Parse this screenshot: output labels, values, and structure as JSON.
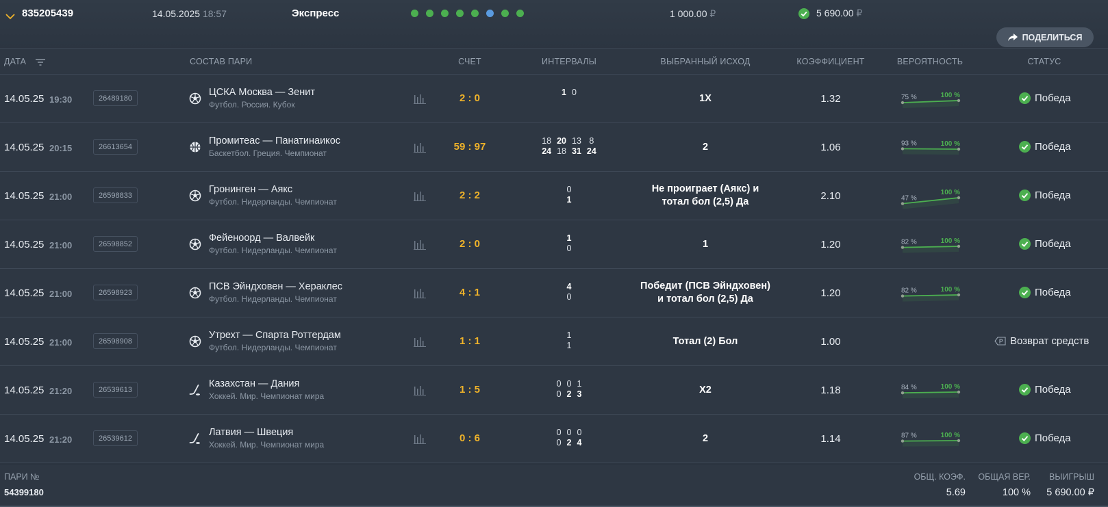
{
  "header": {
    "bet_number": "835205439",
    "date": "14.05.2025",
    "time": "18:57",
    "bet_type": "Экспресс",
    "event_dots": [
      "green",
      "green",
      "green",
      "green",
      "green",
      "blue",
      "green",
      "green"
    ],
    "stake_amount": "1 000.00",
    "currency": "₽",
    "win_amount": "5 690.00",
    "share_label": "ПОДЕЛИТЬСЯ"
  },
  "columns": {
    "date": "ДАТА",
    "pair": "СОСТАВ ПАРИ",
    "score": "СЧЕТ",
    "intervals": "ИНТЕРВАЛЫ",
    "outcome": "ВЫБРАННЫЙ ИСХОД",
    "coefficient": "КОЭФФИЦИЕНТ",
    "probability": "ВЕРОЯТНОСТЬ",
    "status": "СТАТУС"
  },
  "rows": [
    {
      "date": "14.05.25",
      "time": "19:30",
      "event_id": "26489180",
      "sport_icon": "football-icon",
      "teams": "ЦСКА Москва — Зенит",
      "league": "Футбол. Россия. Кубок",
      "score": "2 : 0",
      "interval_cols": 2,
      "intervals": [
        [
          "1"
        ],
        [
          "0"
        ]
      ],
      "interval_bold": [
        [
          true
        ],
        [
          false
        ]
      ],
      "outcome_lines": [
        "1X"
      ],
      "coef": "1.32",
      "prob_from": "75 %",
      "prob_to": "100 %",
      "prob_from_value": 0.75,
      "status": "Победа",
      "status_icon": "check-circle-icon"
    },
    {
      "date": "14.05.25",
      "time": "20:15",
      "event_id": "26613654",
      "sport_icon": "basketball-icon",
      "teams": "Промитеас — Панатинаикос",
      "league": "Баскетбол. Греция. Чемпионат",
      "score": "59 : 97",
      "interval_cols": 4,
      "intervals": [
        [
          "18",
          "20",
          "13",
          "8"
        ],
        [
          "24",
          "18",
          "31",
          "24"
        ]
      ],
      "interval_bold": [
        [
          false,
          true,
          false,
          false
        ],
        [
          true,
          false,
          true,
          true
        ]
      ],
      "outcome_lines": [
        "2"
      ],
      "coef": "1.06",
      "prob_from": "93 %",
      "prob_to": "100 %",
      "prob_from_value": 0.93,
      "status": "Победа",
      "status_icon": "check-circle-icon"
    },
    {
      "date": "14.05.25",
      "time": "21:00",
      "event_id": "26598833",
      "sport_icon": "football-icon",
      "teams": "Гронинген — Аякс",
      "league": "Футбол. Нидерланды. Чемпионат",
      "score": "2 : 2",
      "interval_cols": 1,
      "intervals": [
        [
          "0"
        ],
        [
          "1"
        ]
      ],
      "interval_bold": [
        [
          false
        ],
        [
          true
        ]
      ],
      "outcome_lines": [
        "Не проиграет (Аякс) и",
        "тотал бол (2,5) Да"
      ],
      "coef": "2.10",
      "prob_from": "47 %",
      "prob_to": "100 %",
      "prob_from_value": 0.47,
      "status": "Победа",
      "status_icon": "check-circle-icon"
    },
    {
      "date": "14.05.25",
      "time": "21:00",
      "event_id": "26598852",
      "sport_icon": "football-icon",
      "teams": "Фейеноорд — Валвейк",
      "league": "Футбол. Нидерланды. Чемпионат",
      "score": "2 : 0",
      "interval_cols": 1,
      "intervals": [
        [
          "1"
        ],
        [
          "0"
        ]
      ],
      "interval_bold": [
        [
          true
        ],
        [
          false
        ]
      ],
      "outcome_lines": [
        "1"
      ],
      "coef": "1.20",
      "prob_from": "82 %",
      "prob_to": "100 %",
      "prob_from_value": 0.82,
      "status": "Победа",
      "status_icon": "check-circle-icon"
    },
    {
      "date": "14.05.25",
      "time": "21:00",
      "event_id": "26598923",
      "sport_icon": "football-icon",
      "teams": "ПСВ Эйндховен — Хераклес",
      "league": "Футбол. Нидерланды. Чемпионат",
      "score": "4 : 1",
      "interval_cols": 1,
      "intervals": [
        [
          "4"
        ],
        [
          "0"
        ]
      ],
      "interval_bold": [
        [
          true
        ],
        [
          false
        ]
      ],
      "outcome_lines": [
        "Победит (ПСВ Эйндховен)",
        "и тотал бол (2,5) Да"
      ],
      "coef": "1.20",
      "prob_from": "82 %",
      "prob_to": "100 %",
      "prob_from_value": 0.82,
      "status": "Победа",
      "status_icon": "check-circle-icon"
    },
    {
      "date": "14.05.25",
      "time": "21:00",
      "event_id": "26598908",
      "sport_icon": "football-icon",
      "teams": "Утрехт — Спарта Роттердам",
      "league": "Футбол. Нидерланды. Чемпионат",
      "score": "1 : 1",
      "interval_cols": 1,
      "intervals": [
        [
          "1"
        ],
        [
          "1"
        ]
      ],
      "interval_bold": [
        [
          false
        ],
        [
          false
        ]
      ],
      "outcome_lines": [
        "Тотал (2) Бол"
      ],
      "coef": "1.00",
      "prob_from": "",
      "prob_to": "",
      "prob_from_value": null,
      "status": "Возврат средств",
      "status_icon": "refund-icon"
    },
    {
      "date": "14.05.25",
      "time": "21:20",
      "event_id": "26539613",
      "sport_icon": "hockey-icon",
      "teams": "Казахстан — Дания",
      "league": "Хоккей. Мир. Чемпионат мира",
      "score": "1 : 5",
      "interval_cols": 3,
      "intervals": [
        [
          "0",
          "0",
          "1"
        ],
        [
          "0",
          "2",
          "3"
        ]
      ],
      "interval_bold": [
        [
          false,
          false,
          false
        ],
        [
          false,
          true,
          true
        ]
      ],
      "outcome_lines": [
        "X2"
      ],
      "coef": "1.18",
      "prob_from": "84 %",
      "prob_to": "100 %",
      "prob_from_value": 0.84,
      "status": "Победа",
      "status_icon": "check-circle-icon"
    },
    {
      "date": "14.05.25",
      "time": "21:20",
      "event_id": "26539612",
      "sport_icon": "hockey-icon",
      "teams": "Латвия — Швеция",
      "league": "Хоккей. Мир. Чемпионат мира",
      "score": "0 : 6",
      "interval_cols": 3,
      "intervals": [
        [
          "0",
          "0",
          "0"
        ],
        [
          "0",
          "2",
          "4"
        ]
      ],
      "interval_bold": [
        [
          false,
          false,
          false
        ],
        [
          false,
          true,
          true
        ]
      ],
      "outcome_lines": [
        "2"
      ],
      "coef": "1.14",
      "prob_from": "87 %",
      "prob_to": "100 %",
      "prob_from_value": 0.87,
      "status": "Победа",
      "status_icon": "check-circle-icon"
    }
  ],
  "footer": {
    "pair_label": "ПАРИ №",
    "pair_number": "54399180",
    "total_coef_label": "ОБЩ. КОЭФ.",
    "total_coef": "5.69",
    "total_prob_label": "ОБЩАЯ ВЕР.",
    "total_prob": "100 %",
    "win_label": "ВЫИГРЫШ",
    "win_amount": "5 690.00 ₽"
  },
  "colors": {
    "background": "#2b3440",
    "score": "#f0b32a",
    "success": "#4caf50",
    "dot_blue": "#5a9be0"
  }
}
